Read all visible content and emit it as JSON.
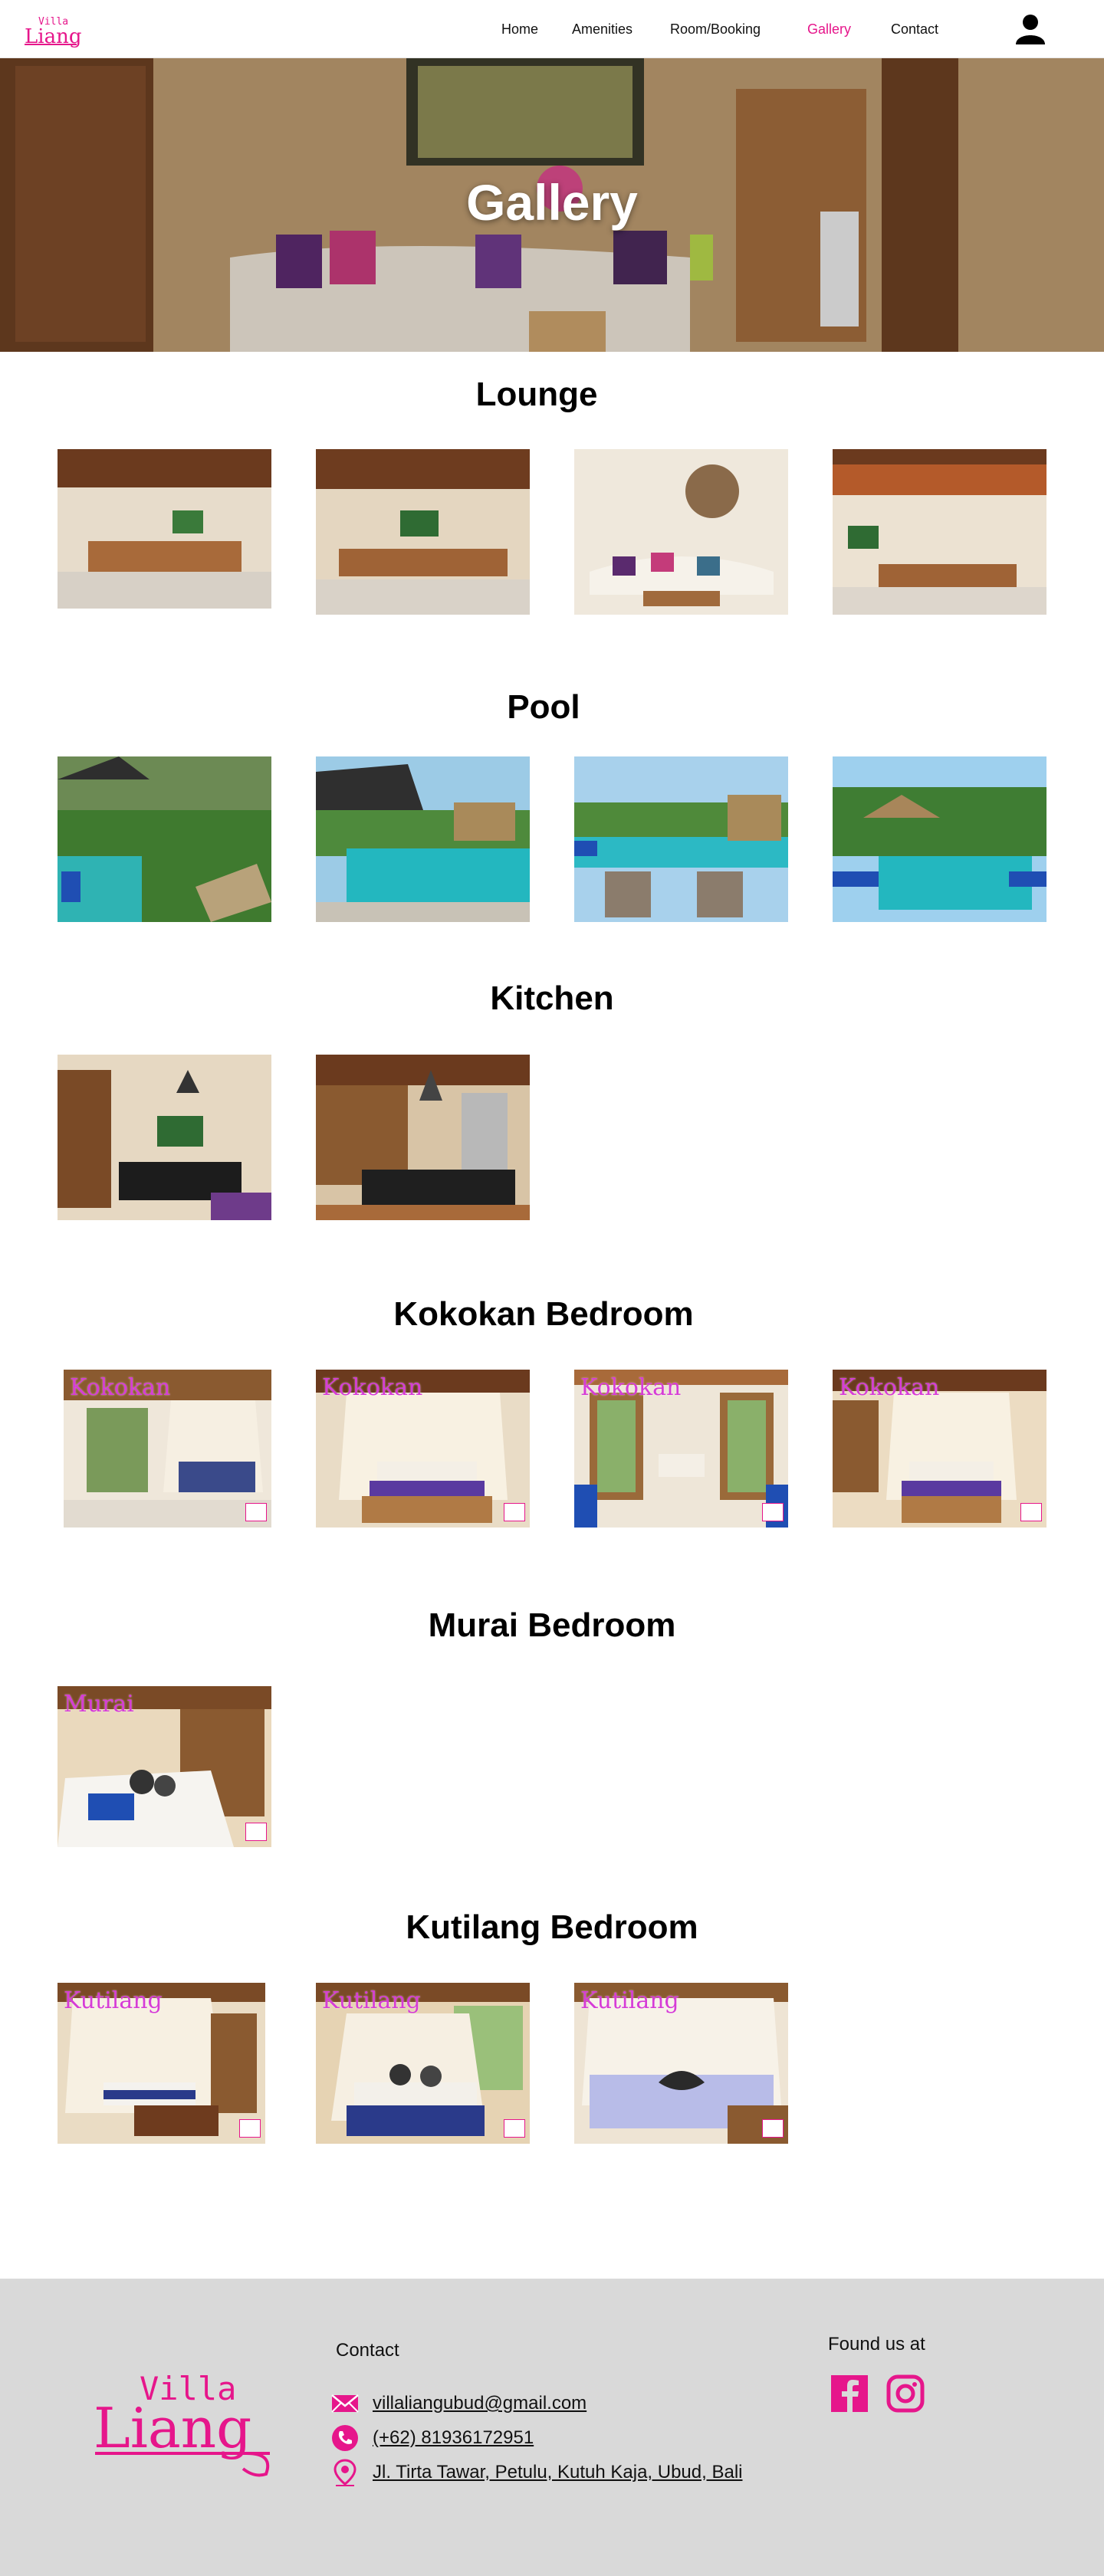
{
  "nav": {
    "brand_top": "Villa",
    "brand_bottom": "Liang",
    "links": [
      "Home",
      "Amenities",
      "Room/Booking",
      "Gallery",
      "Contact"
    ],
    "active_index": 3
  },
  "hero": {
    "title": "Gallery"
  },
  "sections": [
    {
      "title": "Lounge"
    },
    {
      "title": "Pool"
    },
    {
      "title": "Kitchen"
    },
    {
      "title": "Kokokan Bedroom",
      "tag": "Kokokan"
    },
    {
      "title": "Murai Bedroom",
      "tag": "Murai"
    },
    {
      "title": "Kutilang Bedroom",
      "tag": "Kutilang"
    }
  ],
  "footer": {
    "brand_top": "Villa",
    "brand_bottom": "Liang",
    "contact_title": "Contact",
    "email": "villaliangubud@gmail.com",
    "phone": "(+62) 81936172951",
    "address": "Jl. Tirta Tawar, Petulu, Kutuh Kaja, Ubud, Bali",
    "found_title": "Found us at"
  },
  "colors": {
    "accent": "#e6168b",
    "footer_bg": "#d9d9d9"
  }
}
